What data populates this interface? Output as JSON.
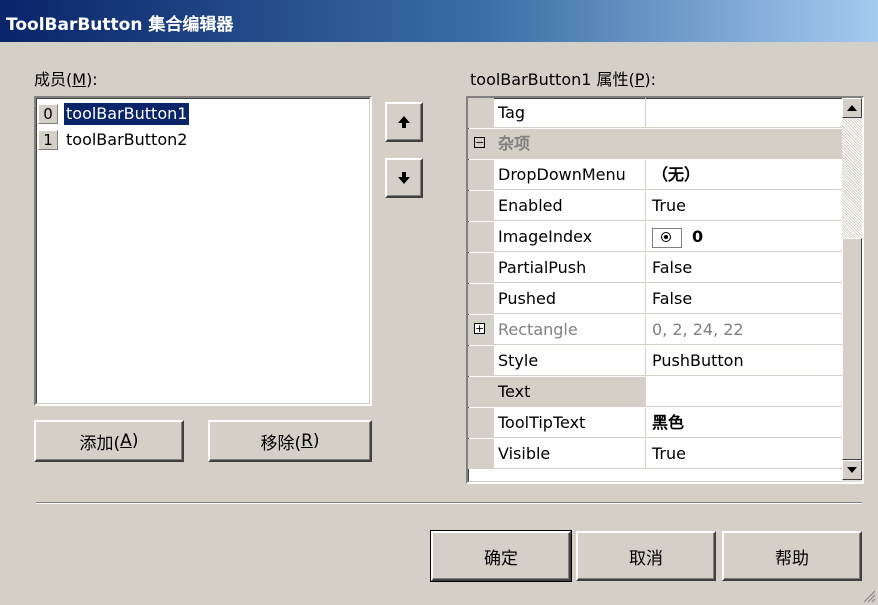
{
  "window": {
    "title": "ToolBarButton 集合编辑器"
  },
  "members": {
    "label": "成员(",
    "hotkey": "M",
    "label_end": "):",
    "items": [
      {
        "index": "0",
        "name": "toolBarButton1",
        "selected": true
      },
      {
        "index": "1",
        "name": "toolBarButton2",
        "selected": false
      }
    ]
  },
  "move_up_icon": "arrow-up-icon",
  "move_down_icon": "arrow-down-icon",
  "properties": {
    "label": "toolBarButton1 属性(",
    "hotkey": "P",
    "label_end": "):",
    "rows": [
      {
        "name": "Tag",
        "value": ""
      },
      {
        "name": "杂项",
        "value": "",
        "category": true,
        "expander": "⊟"
      },
      {
        "name": "DropDownMenu",
        "value": "（无）",
        "bold": true
      },
      {
        "name": "Enabled",
        "value": "True"
      },
      {
        "name": "ImageIndex",
        "value": "0",
        "bold": true,
        "icon": "image-preview-icon"
      },
      {
        "name": "PartialPush",
        "value": "False"
      },
      {
        "name": "Pushed",
        "value": "False"
      },
      {
        "name": "Rectangle",
        "value": "0, 2, 24, 22",
        "grey": true,
        "expander": "⊞"
      },
      {
        "name": "Style",
        "value": "PushButton"
      },
      {
        "name": "Text",
        "value": "",
        "selected": true
      },
      {
        "name": "ToolTipText",
        "value": "黑色",
        "bold": true
      },
      {
        "name": "Visible",
        "value": "True"
      }
    ]
  },
  "buttons": {
    "add": {
      "text": "添加(",
      "hotkey": "A",
      "end": ")"
    },
    "remove": {
      "text": "移除(",
      "hotkey": "R",
      "end": ")"
    },
    "ok": "确定",
    "cancel": "取消",
    "help": "帮助"
  },
  "colors": {
    "title_start": "#0a246a",
    "title_end": "#a6caf0",
    "selection": "#0a246a",
    "face": "#d4d0c8"
  }
}
